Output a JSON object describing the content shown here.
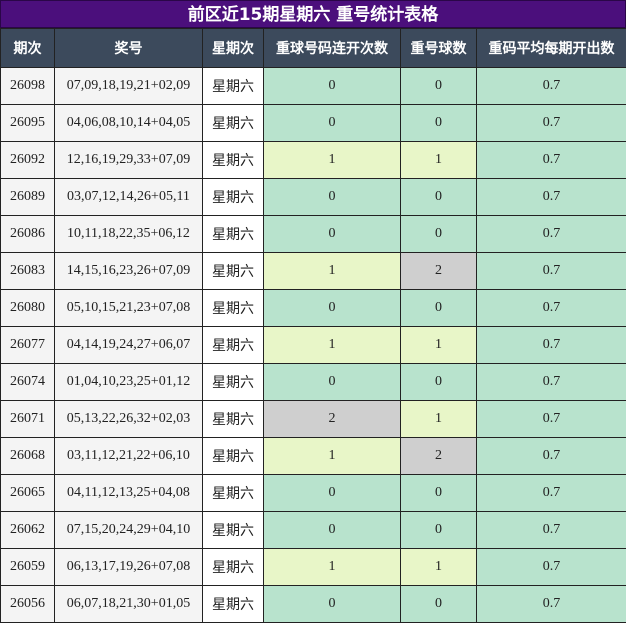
{
  "title": "前区近15期星期六 重号统计表格",
  "headers": [
    "期次",
    "奖号",
    "星期次",
    "重球号码连开次数",
    "重号球数",
    "重码平均每期开出数"
  ],
  "rows": [
    {
      "period": "26098",
      "numbers": "07,09,18,19,21+02,09",
      "weekday": "星期六",
      "consecutive": "0",
      "repeat": "0",
      "avg": "0.7"
    },
    {
      "period": "26095",
      "numbers": "04,06,08,10,14+04,05",
      "weekday": "星期六",
      "consecutive": "0",
      "repeat": "0",
      "avg": "0.7"
    },
    {
      "period": "26092",
      "numbers": "12,16,19,29,33+07,09",
      "weekday": "星期六",
      "consecutive": "1",
      "repeat": "1",
      "avg": "0.7"
    },
    {
      "period": "26089",
      "numbers": "03,07,12,14,26+05,11",
      "weekday": "星期六",
      "consecutive": "0",
      "repeat": "0",
      "avg": "0.7"
    },
    {
      "period": "26086",
      "numbers": "10,11,18,22,35+06,12",
      "weekday": "星期六",
      "consecutive": "0",
      "repeat": "0",
      "avg": "0.7"
    },
    {
      "period": "26083",
      "numbers": "14,15,16,23,26+07,09",
      "weekday": "星期六",
      "consecutive": "1",
      "repeat": "2",
      "avg": "0.7"
    },
    {
      "period": "26080",
      "numbers": "05,10,15,21,23+07,08",
      "weekday": "星期六",
      "consecutive": "0",
      "repeat": "0",
      "avg": "0.7"
    },
    {
      "period": "26077",
      "numbers": "04,14,19,24,27+06,07",
      "weekday": "星期六",
      "consecutive": "1",
      "repeat": "1",
      "avg": "0.7"
    },
    {
      "period": "26074",
      "numbers": "01,04,10,23,25+01,12",
      "weekday": "星期六",
      "consecutive": "0",
      "repeat": "0",
      "avg": "0.7"
    },
    {
      "period": "26071",
      "numbers": "05,13,22,26,32+02,03",
      "weekday": "星期六",
      "consecutive": "2",
      "repeat": "1",
      "avg": "0.7"
    },
    {
      "period": "26068",
      "numbers": "03,11,12,21,22+06,10",
      "weekday": "星期六",
      "consecutive": "1",
      "repeat": "2",
      "avg": "0.7"
    },
    {
      "period": "26065",
      "numbers": "04,11,12,13,25+04,08",
      "weekday": "星期六",
      "consecutive": "0",
      "repeat": "0",
      "avg": "0.7"
    },
    {
      "period": "26062",
      "numbers": "07,15,20,24,29+04,10",
      "weekday": "星期六",
      "consecutive": "0",
      "repeat": "0",
      "avg": "0.7"
    },
    {
      "period": "26059",
      "numbers": "06,13,17,19,26+07,08",
      "weekday": "星期六",
      "consecutive": "1",
      "repeat": "1",
      "avg": "0.7"
    },
    {
      "period": "26056",
      "numbers": "06,07,18,21,30+01,05",
      "weekday": "星期六",
      "consecutive": "0",
      "repeat": "0",
      "avg": "0.7"
    }
  ],
  "colors": {
    "title_bg": "#4b0f7c",
    "header_bg": "#3c4a5c",
    "value_0": "#b8e3cd",
    "value_1": "#e8f6c8",
    "value_2": "#cfcfcf"
  }
}
